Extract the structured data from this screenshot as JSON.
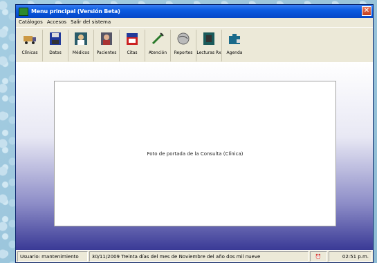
{
  "window": {
    "title": "Menu principal (Versión Beta)"
  },
  "menu": [
    "Catálogos",
    "Accesos",
    "Salir del sistema"
  ],
  "toolbar": [
    {
      "label": "Clínicas",
      "icon": "truck-icon"
    },
    {
      "label": "Datos",
      "icon": "floppy-disk-icon"
    },
    {
      "label": "Médicos",
      "icon": "doctor-icon"
    },
    {
      "label": "Pacientes",
      "icon": "patient-icon"
    },
    {
      "label": "Citas",
      "icon": "calendar-icon"
    },
    {
      "label": "Atención",
      "icon": "syringe-icon"
    },
    {
      "label": "Reportes",
      "icon": "globe-icon"
    },
    {
      "label": "Lecturas Rx",
      "icon": "xray-icon"
    },
    {
      "label": "Agenda",
      "icon": "briefcase-icon"
    }
  ],
  "panel": {
    "text": "Foto de portada de la Consulta (Clínica)"
  },
  "status": {
    "user": "Usuario: mantenimiento",
    "date": "30/11/2009  Treinta días del mes de Noviembre del año dos mil nueve",
    "time": "02:51 p.m."
  },
  "colors": {
    "accent": "#0b5be0",
    "close": "#c33d1e"
  }
}
